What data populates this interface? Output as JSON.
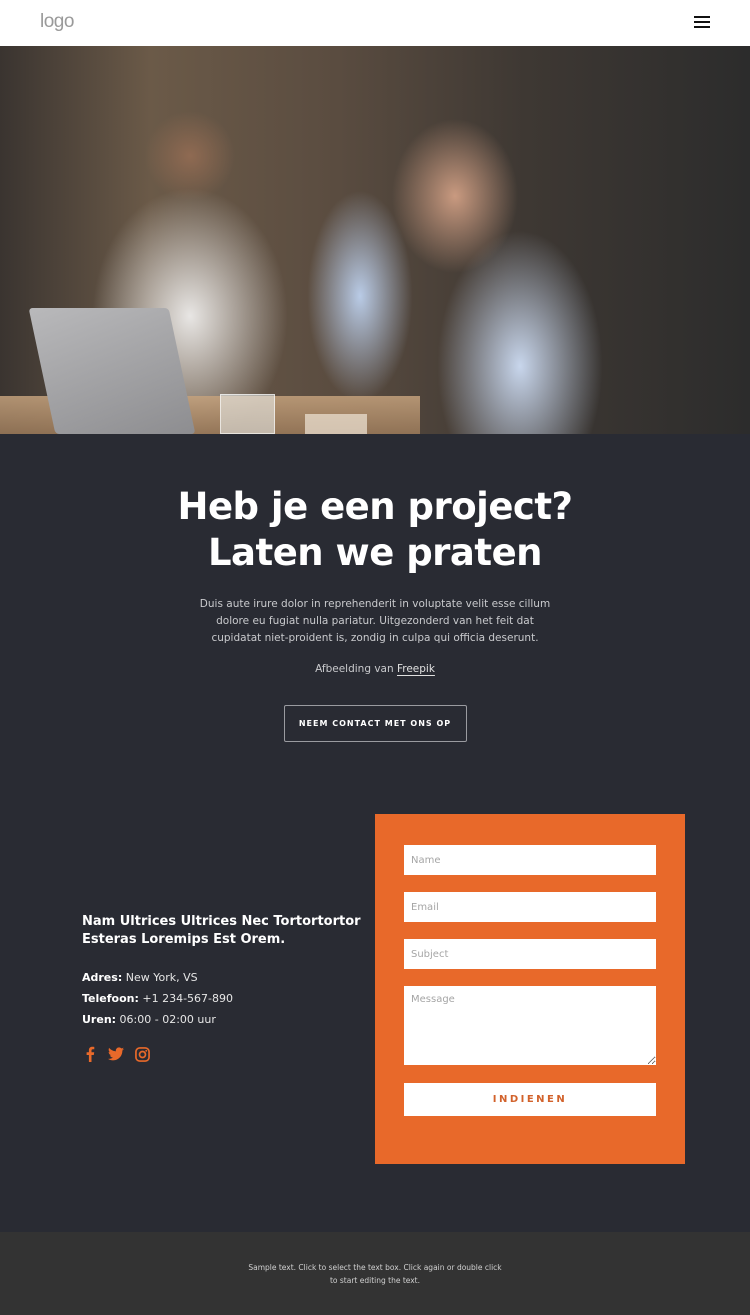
{
  "header": {
    "logo": "logo",
    "menu_icon": "hamburger-menu-icon"
  },
  "hero": {
    "image_description": "Three colleagues working at a cafe table with a laptop; woman in light blue shirt smiling at camera"
  },
  "cta": {
    "title_line1": "Heb je een project?",
    "title_line2": "Laten we praten",
    "description": "Duis aute irure dolor in reprehenderit in voluptate velit esse cillum dolore eu fugiat nulla pariatur. Uitgezonderd van het feit dat cupidatat niet-proident is, zondig in culpa qui officia deserunt.",
    "credit_prefix": "Afbeelding van ",
    "credit_link": "Freepik",
    "button_label": "NEEM CONTACT MET ONS OP"
  },
  "contact": {
    "heading": "Nam Ultrices Ultrices Nec Tortortortor Esteras Loremips Est Orem.",
    "rows": [
      {
        "label": "Adres:",
        "value": " New York, VS"
      },
      {
        "label": "Telefoon:",
        "value": " +1 234-567-890"
      },
      {
        "label": "Uren:",
        "value": " 06:00 - 02:00 uur"
      }
    ],
    "social": [
      "facebook-icon",
      "twitter-icon",
      "instagram-icon"
    ],
    "accent_color": "#e8692a"
  },
  "form": {
    "name_placeholder": "Name",
    "email_placeholder": "Email",
    "subject_placeholder": "Subject",
    "message_placeholder": "Message",
    "submit_label": "INDIENEN",
    "background_color": "#e8692a"
  },
  "footer": {
    "text": "Sample text. Click to select the text box. Click again or double click to start editing the text."
  }
}
